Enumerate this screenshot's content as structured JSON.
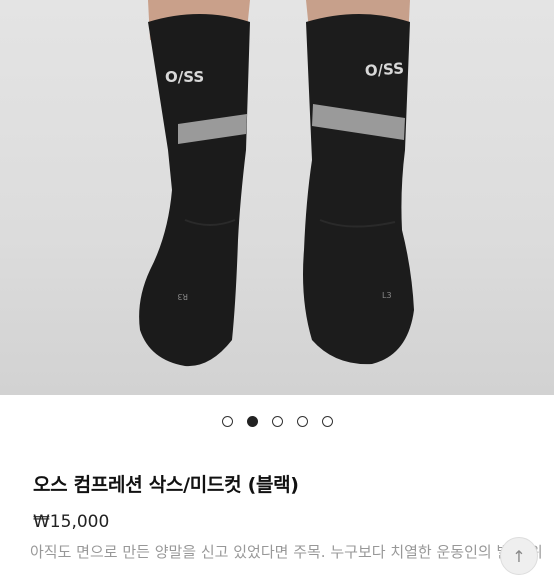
{
  "product": {
    "title": "오스 컴프레션 삭스/미드컷 (블랙)",
    "price": "₩15,000",
    "description_preview": "아직도 면으로 만든 양말을 신고 있었다면 주목. 누구보다 치열한 운동인의 발을 위"
  },
  "gallery": {
    "image_count": 5,
    "active_index": 1,
    "sock_left_text": "O/SS",
    "sock_right_text": "O/SS",
    "sock_left_code": "R3",
    "sock_right_code": "L3"
  },
  "colors": {
    "sock": "#1b1b1b",
    "stripe": "#9a9a9a",
    "background": "#e0e0e0",
    "skin": "#c9a08a"
  },
  "icons": {
    "fab": "arrow-up-icon"
  }
}
